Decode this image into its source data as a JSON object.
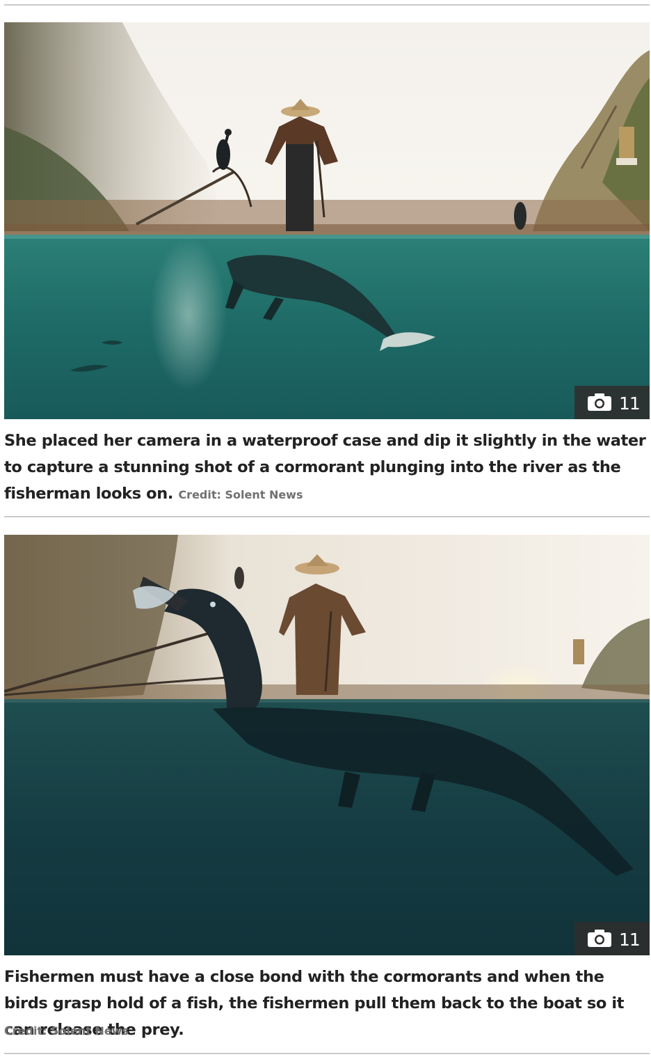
{
  "gallery": [
    {
      "photo_alt": "Cormorant plunging into the river as the fisherman looks on",
      "photo_count": "11",
      "caption": "She placed her camera in a waterproof case and dip it slightly in the water to capture a stunning shot of a cormorant plunging into the river as the fisherman looks on.",
      "credit": "Credit: Solent News"
    },
    {
      "photo_alt": "Cormorant holding a fish beside the fisherman's boat",
      "photo_count": "11",
      "caption": "Fishermen must have a close bond with the cormorants and when the birds grasp hold of a fish, the fishermen pull them back to the boat so it can release the prey.",
      "credit": "Credit: Solent News"
    }
  ],
  "icons": {
    "gallery_badge_icon": "camera-icon"
  },
  "colors": {
    "water_teal": "#1d6a66",
    "water_dark": "#0f3a40",
    "badge_bg": "#2d2d2d",
    "caption_text": "#222222",
    "credit_text": "#707070",
    "rule": "#c9c9c9"
  }
}
